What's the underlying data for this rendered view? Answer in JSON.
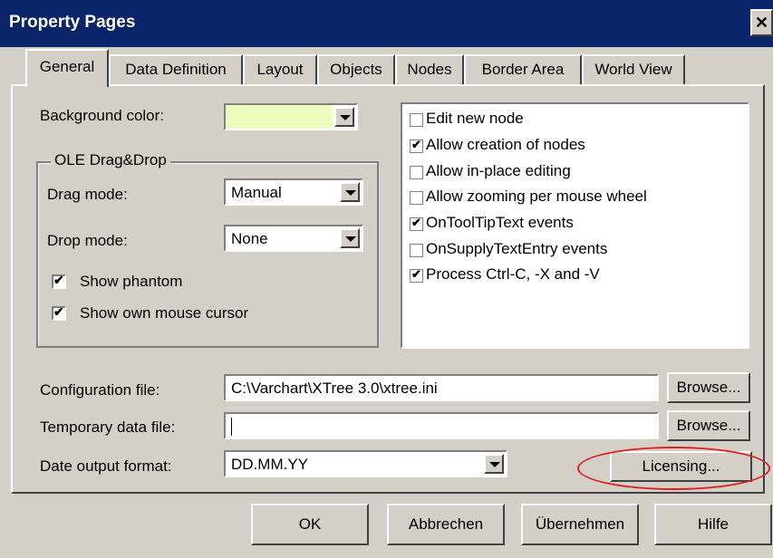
{
  "window": {
    "title": "Property Pages",
    "close_glyph": "✕"
  },
  "tabs": [
    {
      "label": "General",
      "active": true
    },
    {
      "label": "Data Definition",
      "active": false
    },
    {
      "label": "Layout",
      "active": false
    },
    {
      "label": "Objects",
      "active": false
    },
    {
      "label": "Nodes",
      "active": false
    },
    {
      "label": "Border Area",
      "active": false
    },
    {
      "label": "World View",
      "active": false
    }
  ],
  "general": {
    "background_color": {
      "label": "Background color:",
      "value_color": "#ecfcbc"
    },
    "ole_group": {
      "title": "OLE Drag&Drop",
      "drag_mode": {
        "label": "Drag mode:",
        "value": "Manual"
      },
      "drop_mode": {
        "label": "Drop mode:",
        "value": "None"
      },
      "show_phantom": {
        "label": "Show phantom",
        "checked": true
      },
      "show_cursor": {
        "label": "Show own mouse cursor",
        "checked": true
      }
    },
    "options": [
      {
        "label": "Edit new node",
        "checked": false
      },
      {
        "label": "Allow creation of nodes",
        "checked": true
      },
      {
        "label": "Allow in-place editing",
        "checked": false
      },
      {
        "label": "Allow zooming per mouse wheel",
        "checked": false
      },
      {
        "label": "OnToolTipText events",
        "checked": true
      },
      {
        "label": "OnSupplyTextEntry events",
        "checked": false
      },
      {
        "label": "Process Ctrl-C, -X and -V",
        "checked": true
      }
    ],
    "config_file": {
      "label": "Configuration file:",
      "value": "C:\\Varchart\\XTree 3.0\\xtree.ini",
      "browse": "Browse..."
    },
    "temp_file": {
      "label": "Temporary data file:",
      "value": "",
      "browse": "Browse..."
    },
    "date_format": {
      "label": "Date output format:",
      "value": "DD.MM.YY"
    },
    "licensing_button": "Licensing..."
  },
  "footer": {
    "ok": "OK",
    "cancel": "Abbrechen",
    "apply": "Übernehmen",
    "help": "Hilfe"
  },
  "colors": {
    "title_bar": "#0a246a",
    "face": "#d4d0c8",
    "highlight_ellipse": "#e02020"
  },
  "icons": {
    "dropdown": "chevron-down-icon",
    "check": "check-icon",
    "close": "close-icon"
  }
}
